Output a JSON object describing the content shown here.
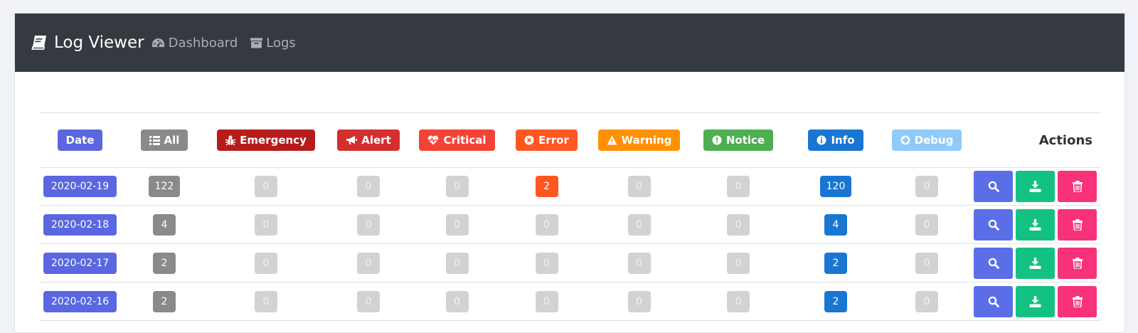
{
  "navbar": {
    "brand": "Log Viewer",
    "links": [
      "Dashboard",
      "Logs"
    ]
  },
  "colors": {
    "navbar_bg": "#343a40",
    "date": "#5a67e0",
    "all": "#8a8a8a",
    "emergency": "#b71c1c",
    "alert": "#d32f2f",
    "critical": "#f44336",
    "error": "#ff5722",
    "warning": "#ff9100",
    "notice": "#4caf50",
    "info": "#1976d2",
    "debug": "#90caf9",
    "show": "#5a6ee8",
    "download": "#13c282",
    "delete": "#f7327a"
  },
  "table": {
    "headers": {
      "date": "Date",
      "all": "All",
      "emergency": "Emergency",
      "alert": "Alert",
      "critical": "Critical",
      "error": "Error",
      "warning": "Warning",
      "notice": "Notice",
      "info": "Info",
      "debug": "Debug",
      "actions": "Actions"
    },
    "header_icons": {
      "all": "list-icon",
      "emergency": "bug-icon",
      "alert": "bullhorn-icon",
      "critical": "heartbeat-icon",
      "error": "times-circle-icon",
      "warning": "exclamation-triangle-icon",
      "notice": "exclamation-circle-icon",
      "info": "info-circle-icon",
      "debug": "life-ring-icon"
    },
    "rows": [
      {
        "date": "2020-02-19",
        "all": "122",
        "emergency": "0",
        "alert": "0",
        "critical": "0",
        "error": "2",
        "warning": "0",
        "notice": "0",
        "info": "120",
        "debug": "0"
      },
      {
        "date": "2020-02-18",
        "all": "4",
        "emergency": "0",
        "alert": "0",
        "critical": "0",
        "error": "0",
        "warning": "0",
        "notice": "0",
        "info": "4",
        "debug": "0"
      },
      {
        "date": "2020-02-17",
        "all": "2",
        "emergency": "0",
        "alert": "0",
        "critical": "0",
        "error": "0",
        "warning": "0",
        "notice": "0",
        "info": "2",
        "debug": "0"
      },
      {
        "date": "2020-02-16",
        "all": "2",
        "emergency": "0",
        "alert": "0",
        "critical": "0",
        "error": "0",
        "warning": "0",
        "notice": "0",
        "info": "2",
        "debug": "0"
      }
    ]
  }
}
